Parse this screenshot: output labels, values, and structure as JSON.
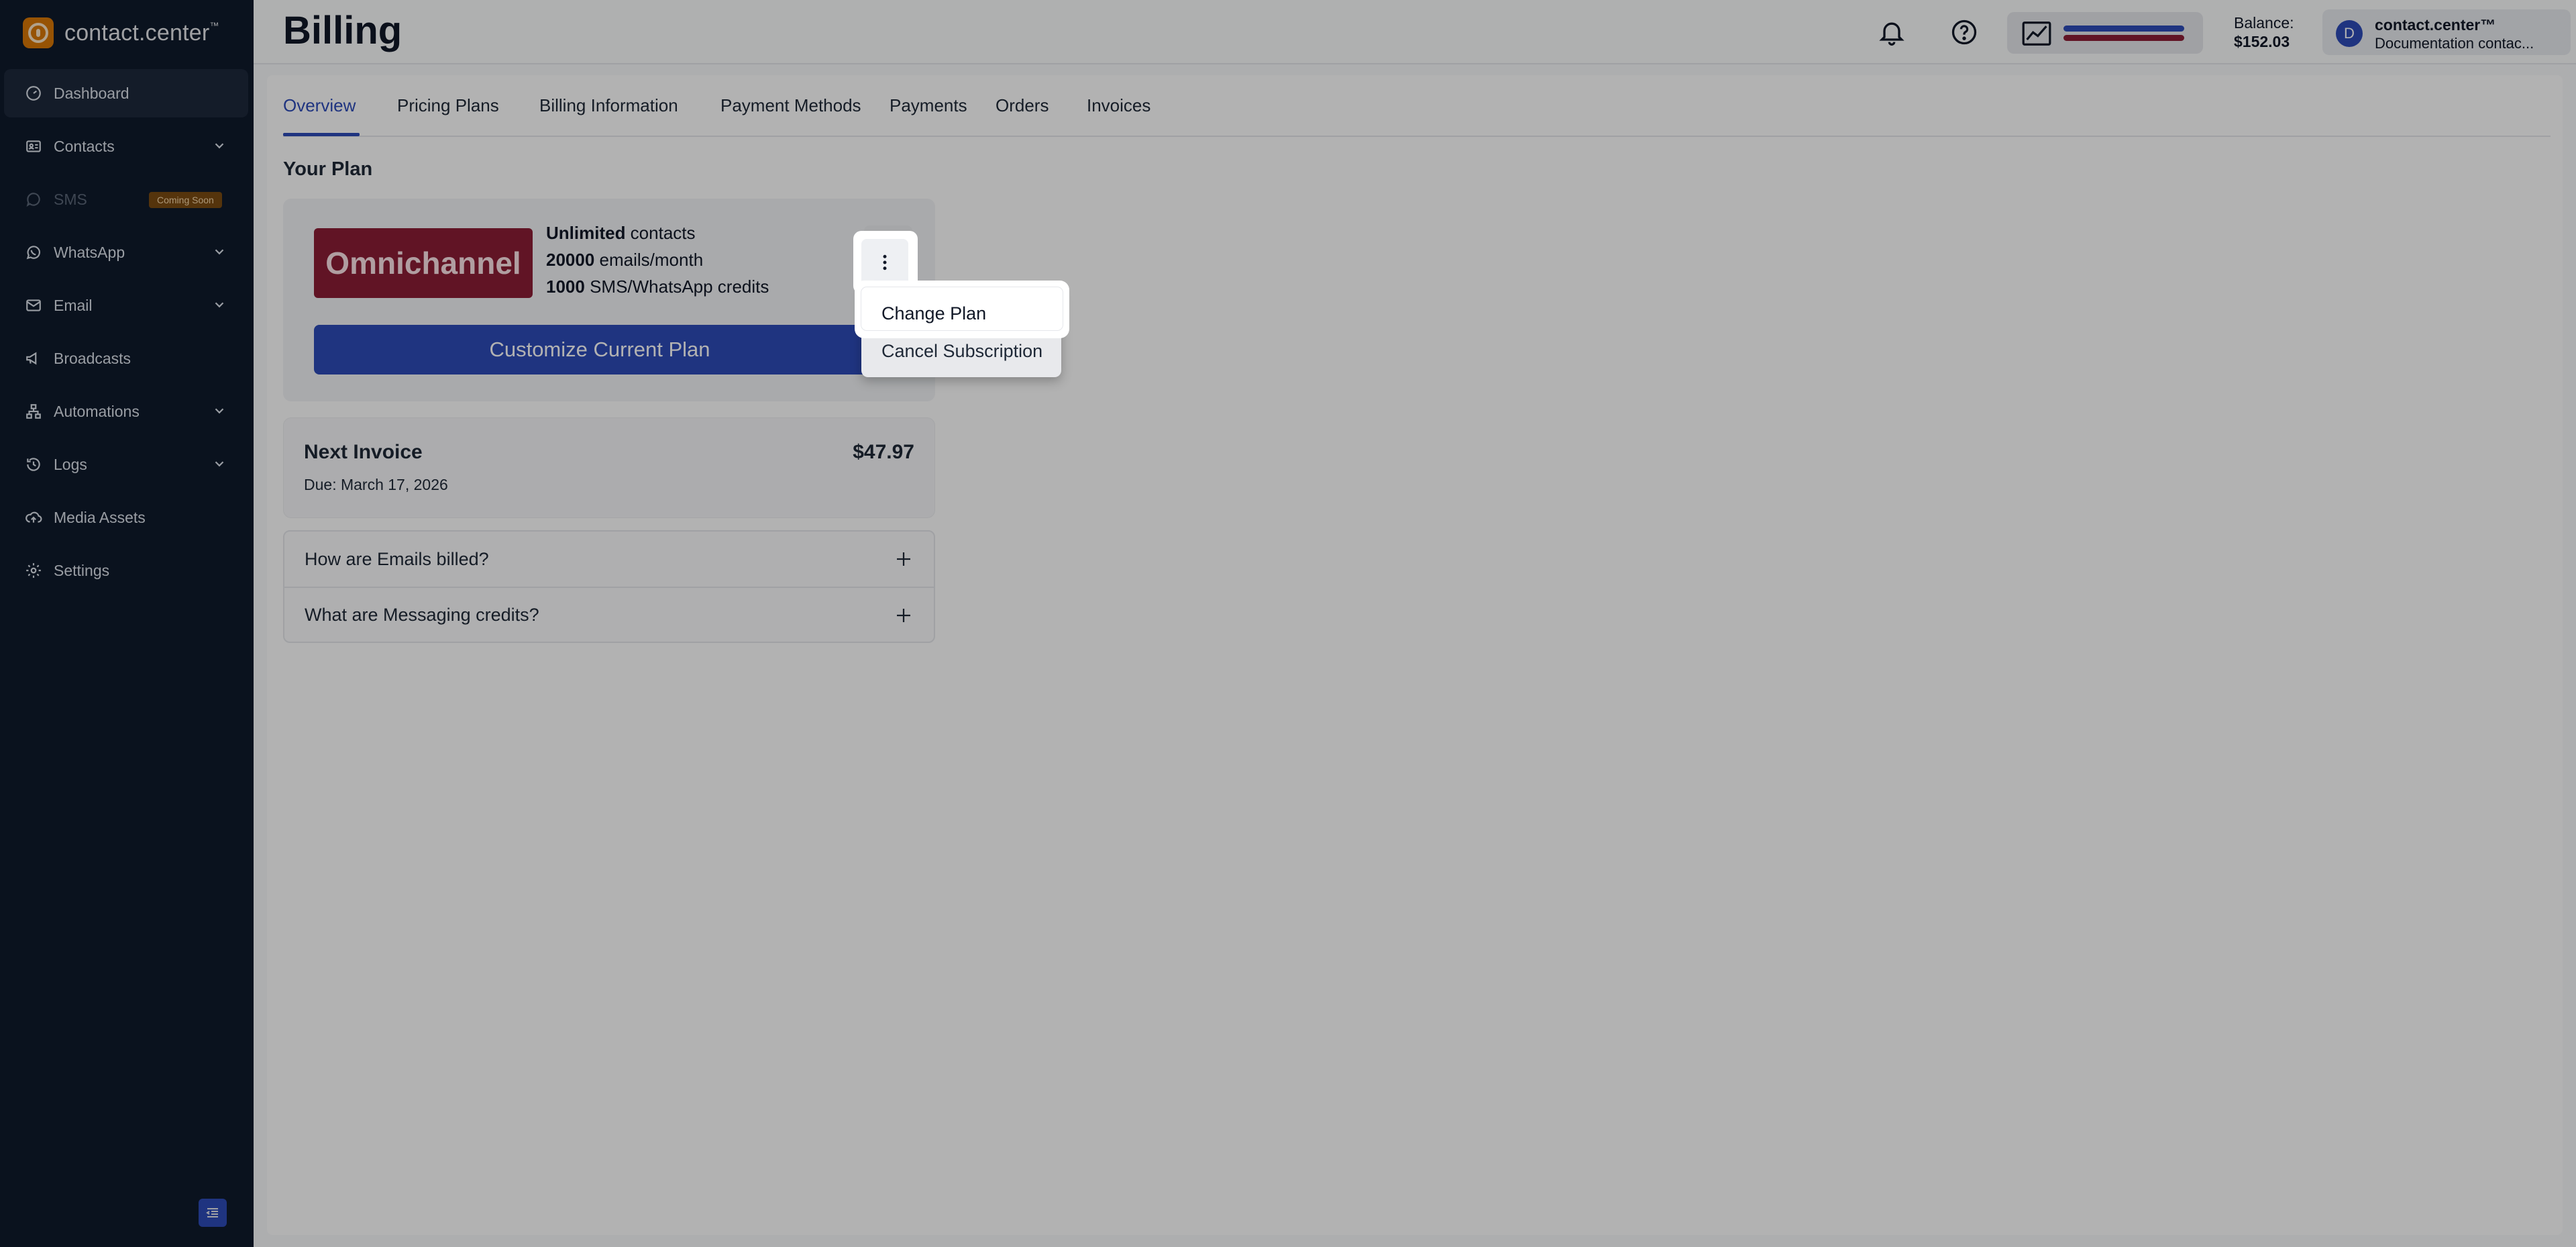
{
  "app": {
    "brand": "contact.center",
    "brand_tm": "™"
  },
  "sidebar": {
    "items": [
      {
        "label": "Dashboard",
        "icon": "dashboard-icon",
        "active": true
      },
      {
        "label": "Contacts",
        "icon": "contacts-icon",
        "expandable": true
      },
      {
        "label": "SMS",
        "icon": "sms-icon",
        "disabled": true,
        "badge": "Coming Soon"
      },
      {
        "label": "WhatsApp",
        "icon": "whatsapp-icon",
        "expandable": true
      },
      {
        "label": "Email",
        "icon": "mail-icon",
        "expandable": true
      },
      {
        "label": "Broadcasts",
        "icon": "megaphone-icon"
      },
      {
        "label": "Automations",
        "icon": "automation-icon",
        "expandable": true
      },
      {
        "label": "Logs",
        "icon": "history-icon",
        "expandable": true
      },
      {
        "label": "Media Assets",
        "icon": "cloud-upload-icon"
      },
      {
        "label": "Settings",
        "icon": "gear-icon"
      }
    ]
  },
  "header": {
    "title": "Billing",
    "balance_label": "Balance:",
    "balance_value": "$152.03",
    "account_initial": "D",
    "account_name": "contact.center™",
    "account_sub": "Documentation contac..."
  },
  "tabs": [
    {
      "label": "Overview",
      "active": true
    },
    {
      "label": "Pricing Plans"
    },
    {
      "label": "Billing Information"
    },
    {
      "label": "Payment Methods"
    },
    {
      "label": "Payments"
    },
    {
      "label": "Orders"
    },
    {
      "label": "Invoices"
    }
  ],
  "plan": {
    "section_title": "Your Plan",
    "name": "Omnichannel",
    "features": [
      {
        "bold": "Unlimited",
        "rest": " contacts"
      },
      {
        "bold": "20000",
        "rest": " emails/month"
      },
      {
        "bold": "1000",
        "rest": " SMS/WhatsApp credits"
      }
    ],
    "customize_label": "Customize Current Plan"
  },
  "invoice": {
    "title": "Next Invoice",
    "due": "Due: March 17, 2026",
    "amount": "$47.97"
  },
  "faq": [
    {
      "question": "How are Emails billed?"
    },
    {
      "question": "What are Messaging credits?"
    }
  ],
  "menu": {
    "items": [
      "Change Plan",
      "Cancel Subscription"
    ]
  },
  "colors": {
    "accent": "#2d4bb8",
    "plan_badge": "#8c1d35",
    "sidebar_bg": "#0f1a2b"
  }
}
